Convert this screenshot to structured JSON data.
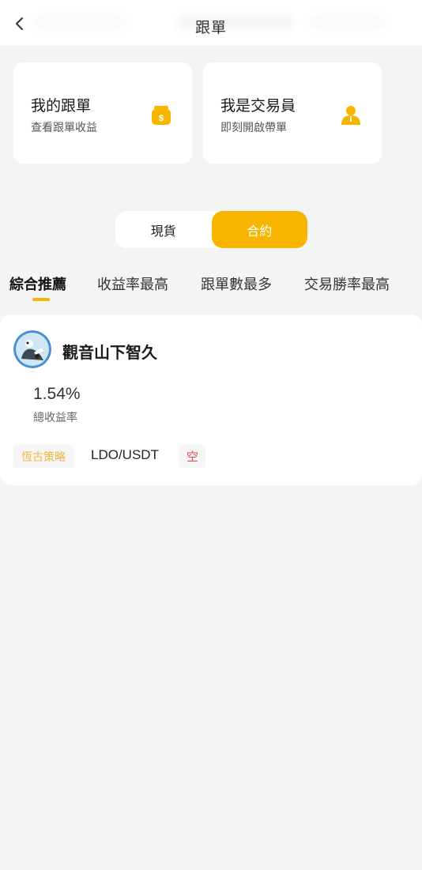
{
  "header": {
    "title": "跟單",
    "back_icon": "chevron-left-icon"
  },
  "entries": [
    {
      "title": "我的跟單",
      "subtitle": "查看跟單收益",
      "icon": "money-bag-icon",
      "icon_color": "#f7b500"
    },
    {
      "title": "我是交易員",
      "subtitle": "即刻開啟帶單",
      "icon": "person-icon",
      "icon_color": "#f7b500"
    }
  ],
  "segment": {
    "options": [
      "現貨",
      "合約"
    ],
    "selected": "合約"
  },
  "sort_tabs": [
    "綜合推薦",
    "收益率最高",
    "跟單數最多",
    "交易勝率最高"
  ],
  "active_sort_tab": "綜合推薦",
  "trader": {
    "name": "觀音山下智久",
    "avatar_icon": "avatar-icon",
    "total_yield": "1.54%",
    "total_yield_label": "總收益率",
    "strategy_tag": "恆古策略",
    "pair": "LDO/USDT",
    "direction_tag": "空"
  },
  "colors": {
    "accent": "#f7b500",
    "short": "#e8454d",
    "background": "#f4f4f4"
  }
}
